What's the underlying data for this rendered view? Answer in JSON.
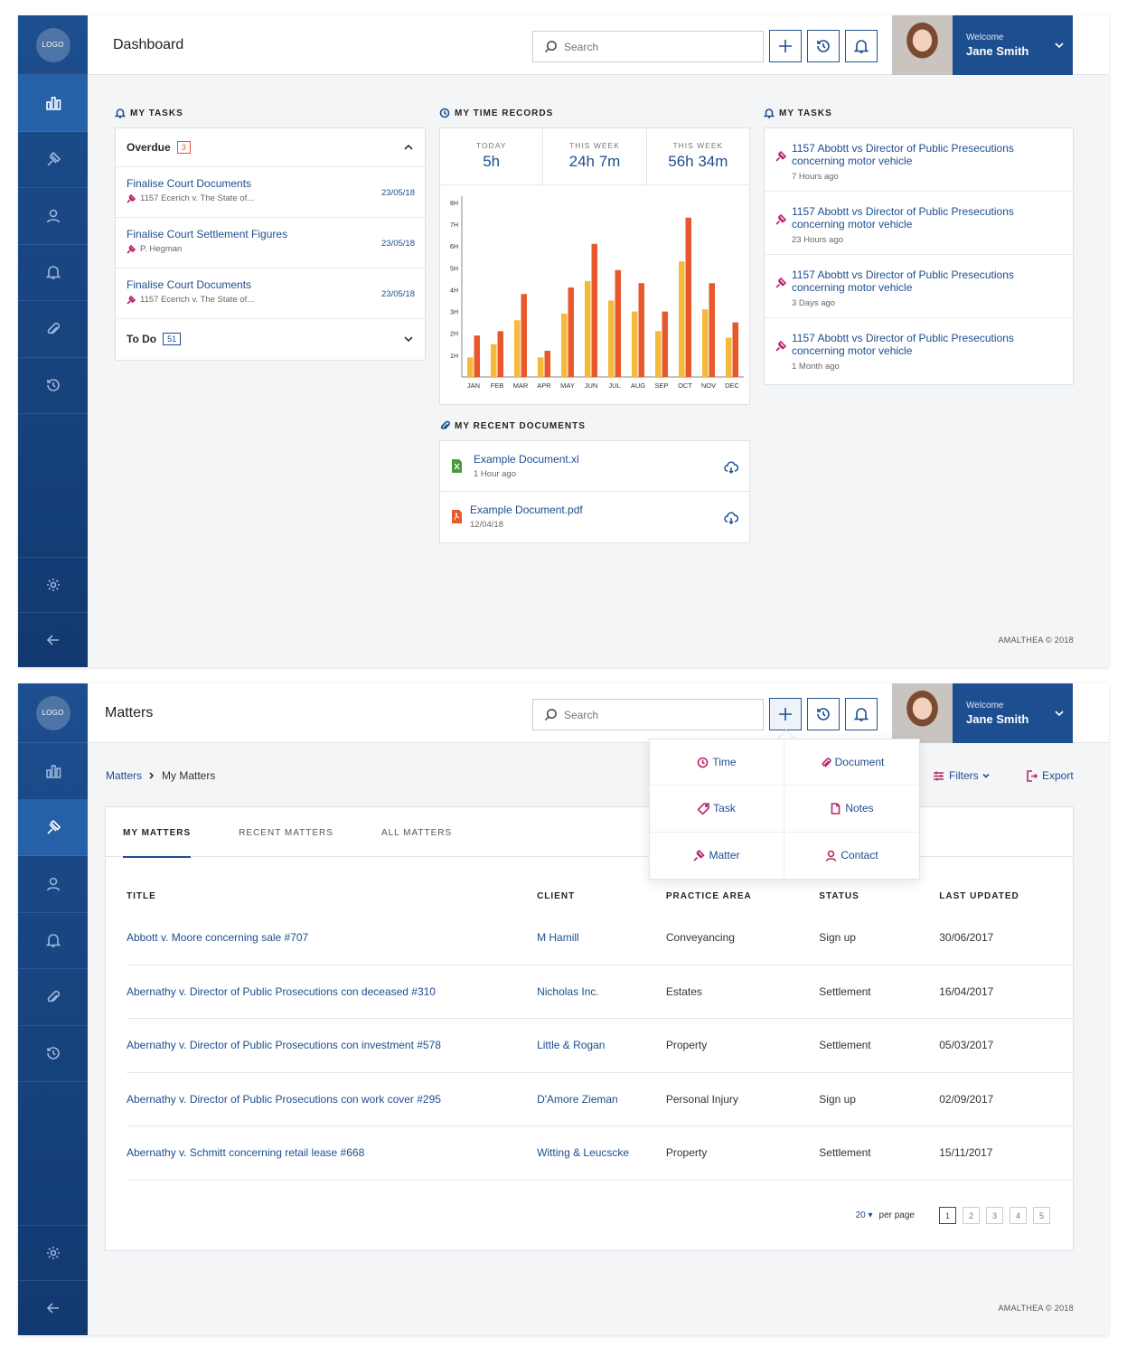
{
  "sidebar": {
    "logo": "LOGO"
  },
  "header": {
    "search_placeholder": "Search",
    "welcome": "Welcome",
    "user_name": "Jane Smith"
  },
  "dashboard": {
    "title": "Dashboard",
    "tasks": {
      "title": "MY TASKS",
      "overdue_label": "Overdue",
      "overdue_count": "3",
      "items": [
        {
          "title": "Finalise Court Documents",
          "sub": "1157 Ecerich v. The State of...",
          "date": "23/05/18"
        },
        {
          "title": "Finalise Court Settlement Figures",
          "sub": "P. Hegman",
          "date": "23/05/18"
        },
        {
          "title": "Finalise Court Documents",
          "sub": "1157 Ecerich v. The State of...",
          "date": "23/05/18"
        }
      ],
      "todo_label": "To Do",
      "todo_count": "51"
    },
    "time": {
      "title": "MY TIME RECORDS",
      "stats": [
        {
          "label": "TODAY",
          "value": "5h"
        },
        {
          "label": "THIS WEEK",
          "value": "24h 7m"
        },
        {
          "label": "THIS WEEK",
          "value": "56h 34m"
        }
      ]
    },
    "notifications": {
      "title": "MY TASKS",
      "items": [
        {
          "title": "1157 Abobtt vs Director of Public Presecutions concerning  motor vehicle",
          "time": "7 Hours ago"
        },
        {
          "title": "1157 Abobtt vs Director of Public Presecutions concerning  motor vehicle",
          "time": "23 Hours ago"
        },
        {
          "title": "1157 Abobtt vs Director of Public Presecutions concerning  motor vehicle",
          "time": "3 Days ago"
        },
        {
          "title": "1157 Abobtt vs Director of Public Presecutions concerning  motor vehicle",
          "time": "1 Month ago"
        }
      ]
    },
    "documents": {
      "title": "MY RECENT DOCUMENTS",
      "items": [
        {
          "name": "Example Document.xl",
          "time": "1 Hour ago",
          "type": "xl"
        },
        {
          "name": "Example Document.pdf",
          "time": "12/04/18",
          "type": "pdf"
        }
      ]
    },
    "footer": "AMALTHEA © 2018"
  },
  "matters": {
    "title": "Matters",
    "breadcrumb": [
      "Matters",
      "My Matters"
    ],
    "filters": "Filters",
    "export": "Export",
    "tabs": [
      "MY MATTERS",
      "RECENT MATTERS",
      "ALL MATTERS"
    ],
    "columns": [
      "TITLE",
      "CLIENT",
      "PRACTICE AREA",
      "STATUS",
      "LAST UPDATED"
    ],
    "rows": [
      [
        "Abbott v. Moore concerning sale #707",
        "M Hamill",
        "Conveyancing",
        "Sign up",
        "30/06/2017"
      ],
      [
        "Abernathy v. Director of Public Prosecutions con deceased #310",
        "Nicholas Inc.",
        "Estates",
        "Settlement",
        "16/04/2017"
      ],
      [
        "Abernathy v. Director of Public Prosecutions con investment #578",
        "Little & Rogan",
        "Property",
        "Settlement",
        "05/03/2017"
      ],
      [
        "Abernathy v. Director of Public Prosecutions con work cover #295",
        "D'Amore Zieman",
        "Personal Injury",
        "Sign up",
        "02/09/2017"
      ],
      [
        "Abernathy v. Schmitt concerning retail lease #668",
        "Witting & Leucscke",
        "Property",
        "Settlement",
        "15/11/2017"
      ]
    ],
    "per_page": "20",
    "per_page_label": "per page",
    "pages": [
      "1",
      "2",
      "3",
      "4",
      "5"
    ],
    "add_menu": [
      "Time",
      "Document",
      "Task",
      "Notes",
      "Matter",
      "Contact"
    ],
    "footer": "AMALTHEA © 2018"
  },
  "chart_data": {
    "type": "bar",
    "categories": [
      "JAN",
      "FEB",
      "MAR",
      "APR",
      "MAY",
      "JUN",
      "JUL",
      "AUG",
      "SEP",
      "OCT",
      "NOV",
      "DEC"
    ],
    "yticks": [
      "1H",
      "2H",
      "3H",
      "4H",
      "5H",
      "6H",
      "7H",
      "8H"
    ],
    "ylim": [
      0,
      8
    ],
    "series": [
      {
        "color": "#f5b93b",
        "values": [
          0.9,
          1.5,
          2.6,
          0.9,
          2.9,
          4.4,
          3.5,
          3.0,
          2.1,
          5.3,
          3.1,
          1.8
        ]
      },
      {
        "color": "#e9582b",
        "values": [
          1.9,
          2.1,
          3.8,
          1.2,
          4.1,
          6.1,
          4.9,
          4.3,
          3.0,
          7.3,
          4.3,
          2.5
        ]
      }
    ]
  }
}
